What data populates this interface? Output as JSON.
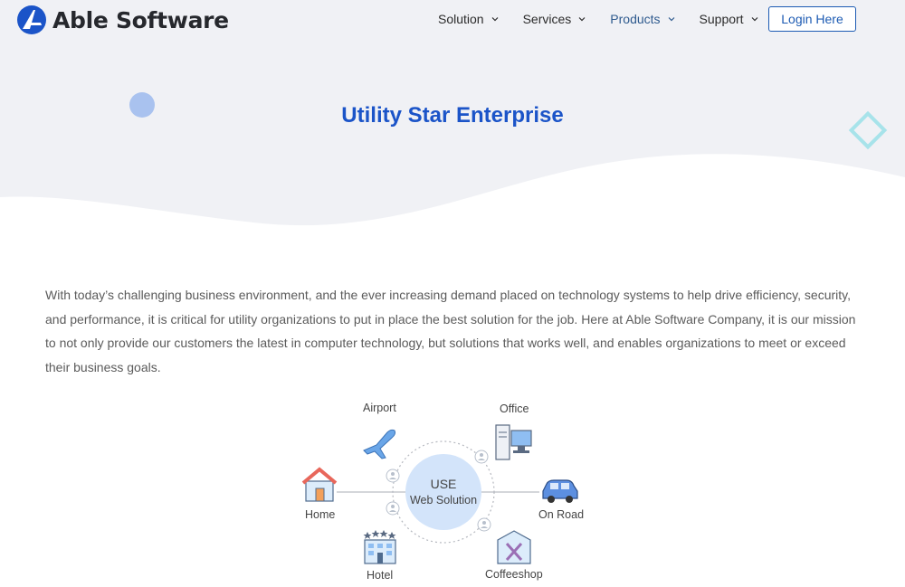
{
  "brand": {
    "name": "Able Software",
    "logo_icon": "able-logo-icon",
    "accent": "#1b54c8"
  },
  "nav": {
    "items": [
      {
        "label": "Solution",
        "active": false
      },
      {
        "label": "Services",
        "active": false
      },
      {
        "label": "Products",
        "active": true
      },
      {
        "label": "Support",
        "active": false
      }
    ],
    "login_label": "Login Here"
  },
  "hero": {
    "title": "Utility Star Enterprise"
  },
  "intro": {
    "text": "With today’s challenging business environment, and the ever increasing demand placed on technology systems to help drive efficiency, security, and performance, it is critical for utility organizations to put in place the best solution for the job. Here at Able Software Company, it is our mission to not only provide our customers the latest in computer technology, but solutions that works well, and enables organizations to meet or exceed their business goals."
  },
  "diagram": {
    "center_line1": "USE",
    "center_line2": "Web Solution",
    "nodes": {
      "airport": "Airport",
      "office": "Office",
      "home": "Home",
      "on_road": "On Road",
      "hotel": "Hotel",
      "coffeeshop": "Coffeeshop"
    }
  }
}
